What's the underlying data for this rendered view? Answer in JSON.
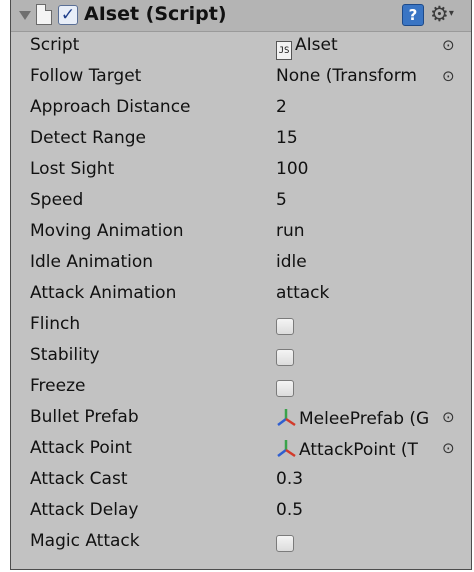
{
  "component": {
    "title": "AIset (Script)",
    "enabled_mark": "✓",
    "help_glyph": "?",
    "gear_glyph": "⚙",
    "menu_caret": "▾"
  },
  "fields": {
    "script": {
      "label": "Script",
      "value": "AIset",
      "icon_text": "JS"
    },
    "follow_target": {
      "label": "Follow Target",
      "value": "None (Transform"
    },
    "approach_distance": {
      "label": "Approach Distance",
      "value": "2"
    },
    "detect_range": {
      "label": "Detect Range",
      "value": "15"
    },
    "lost_sight": {
      "label": "Lost Sight",
      "value": "100"
    },
    "speed": {
      "label": "Speed",
      "value": "5"
    },
    "moving_animation": {
      "label": "Moving Animation",
      "value": "run"
    },
    "idle_animation": {
      "label": "Idle Animation",
      "value": "idle"
    },
    "attack_animation": {
      "label": "Attack Animation",
      "value": "attack"
    },
    "flinch": {
      "label": "Flinch",
      "checked": false
    },
    "stability": {
      "label": "Stability",
      "checked": false
    },
    "freeze": {
      "label": "Freeze",
      "checked": false
    },
    "bullet_prefab": {
      "label": "Bullet Prefab",
      "value": "MeleePrefab (G"
    },
    "attack_point": {
      "label": "Attack Point",
      "value": "AttackPoint (T"
    },
    "attack_cast": {
      "label": "Attack Cast",
      "value": "0.3"
    },
    "attack_delay": {
      "label": "Attack Delay",
      "value": "0.5"
    },
    "magic_attack": {
      "label": "Magic Attack",
      "checked": false
    }
  },
  "picker_glyph": "⊙",
  "colors": {
    "panel_background": "#c2c2c2",
    "header_background": "#b4b4b4",
    "checkbox_accent": "#1f3f8a",
    "help_blue": "#3a75c4"
  }
}
